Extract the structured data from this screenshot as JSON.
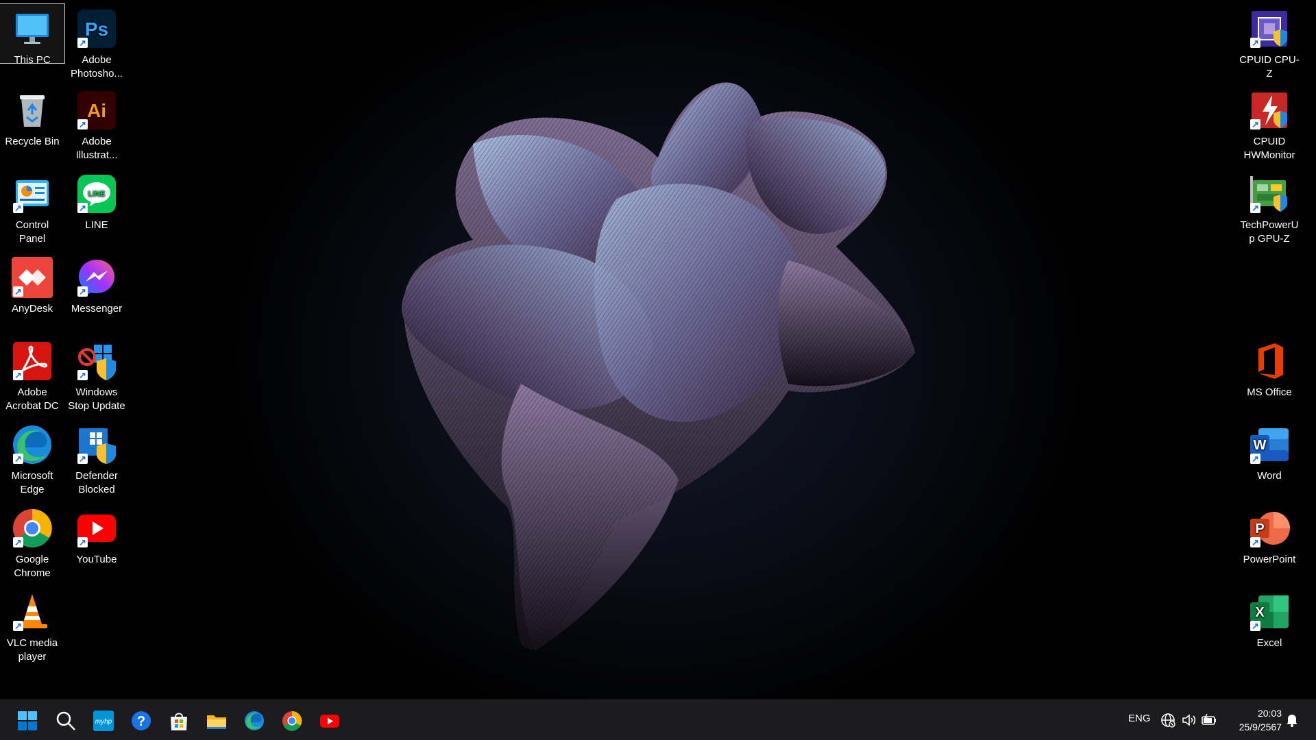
{
  "desktop": {
    "icons": [
      {
        "id": "this-pc",
        "label": "This PC"
      },
      {
        "id": "photoshop",
        "label": "Adobe Photosho..."
      },
      {
        "id": "recycle-bin",
        "label": "Recycle Bin"
      },
      {
        "id": "illustrator",
        "label": "Adobe Illustrat..."
      },
      {
        "id": "control-panel",
        "label": "Control Panel"
      },
      {
        "id": "line",
        "label": "LINE"
      },
      {
        "id": "anydesk",
        "label": "AnyDesk"
      },
      {
        "id": "messenger",
        "label": "Messenger"
      },
      {
        "id": "acrobat",
        "label": "Adobe Acrobat DC"
      },
      {
        "id": "windows-stop-update",
        "label": "Windows Stop Update"
      },
      {
        "id": "edge",
        "label": "Microsoft Edge"
      },
      {
        "id": "defender-blocked",
        "label": "Defender Blocked"
      },
      {
        "id": "chrome",
        "label": "Google Chrome"
      },
      {
        "id": "youtube",
        "label": "YouTube"
      },
      {
        "id": "vlc",
        "label": "VLC media player"
      },
      {
        "id": "cpuz",
        "label": "CPUID CPU-Z"
      },
      {
        "id": "hwmonitor",
        "label": "CPUID HWMonitor"
      },
      {
        "id": "gpuz",
        "label": "TechPowerUp GPU-Z"
      },
      {
        "id": "ms-office",
        "label": "MS Office"
      },
      {
        "id": "word",
        "label": "Word"
      },
      {
        "id": "powerpoint",
        "label": "PowerPoint"
      },
      {
        "id": "excel",
        "label": "Excel"
      }
    ],
    "selected_icon": "this-pc"
  },
  "taskbar": {
    "pinned": [
      {
        "id": "start",
        "icon": "windows-start-icon"
      },
      {
        "id": "search",
        "icon": "search-icon"
      },
      {
        "id": "myhp",
        "icon": "myhp-icon",
        "text": "myhp"
      },
      {
        "id": "help",
        "icon": "help-icon",
        "text": "?"
      },
      {
        "id": "store",
        "icon": "microsoft-store-icon"
      },
      {
        "id": "explorer",
        "icon": "file-explorer-icon"
      },
      {
        "id": "edge",
        "icon": "edge-icon"
      },
      {
        "id": "chrome",
        "icon": "chrome-icon"
      },
      {
        "id": "youtube",
        "icon": "youtube-icon"
      }
    ],
    "tray": {
      "language": "ENG",
      "time": "20:03",
      "date": "25/9/2567"
    }
  },
  "colors": {
    "taskbar_bg": "#1c1c1f",
    "accent_blue": "#0078d4"
  }
}
